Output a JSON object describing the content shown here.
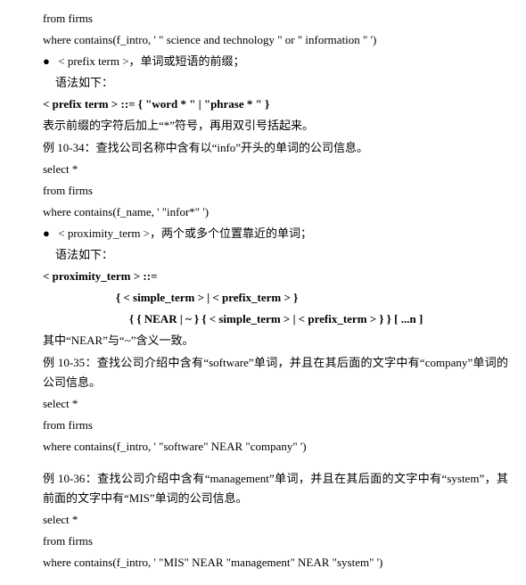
{
  "block1": {
    "lines": [
      "from firms",
      "where contains(f_intro, ' \" science and technology \" or \" information \" ')"
    ]
  },
  "prefix": {
    "bullet": "●",
    "term": "< prefix term >，单词或短语的前缀；",
    "syntaxLabel": "语法如下：",
    "bnf": "< prefix term > ::=   { \"word * \" | \"phrase * \" }",
    "desc": "表示前缀的字符后加上“*”符号，再用双引号括起来。"
  },
  "ex34": {
    "title": "例 10-34：查找公司名称中含有以“info”开头的单词的公司信息。",
    "lines": [
      "select *",
      "from firms",
      "where contains(f_name, ' \"infor*\" ')"
    ]
  },
  "prox": {
    "bullet": "●",
    "term": "< proximity_term >，两个或多个位置靠近的单词；",
    "syntaxLabel": "语法如下：",
    "bnf1": "< proximity_term > ::=",
    "bnf2": "{ < simple_term > | < prefix_term > }",
    "bnf3": "{ { NEAR | ~ } { < simple_term > | < prefix_term > } } [ ...n ]",
    "desc": "其中“NEAR”与“~”含义一致。"
  },
  "ex35": {
    "title": "例 10-35：查找公司介绍中含有“software”单词，并且在其后面的文字中有“company”单词的公司信息。",
    "lines": [
      "select *",
      "from firms",
      "where contains(f_intro, ' \"software\" NEAR \"company\" ')"
    ]
  },
  "ex36": {
    "title": "例 10-36：查找公司介绍中含有“management”单词，并且在其后面的文字中有“system”，其前面的文字中有“MIS”单词的公司信息。",
    "lines": [
      "select *",
      "from firms",
      "where contains(f_intro, ' \"MIS\" NEAR \"management\" NEAR \"system\" ')"
    ]
  }
}
